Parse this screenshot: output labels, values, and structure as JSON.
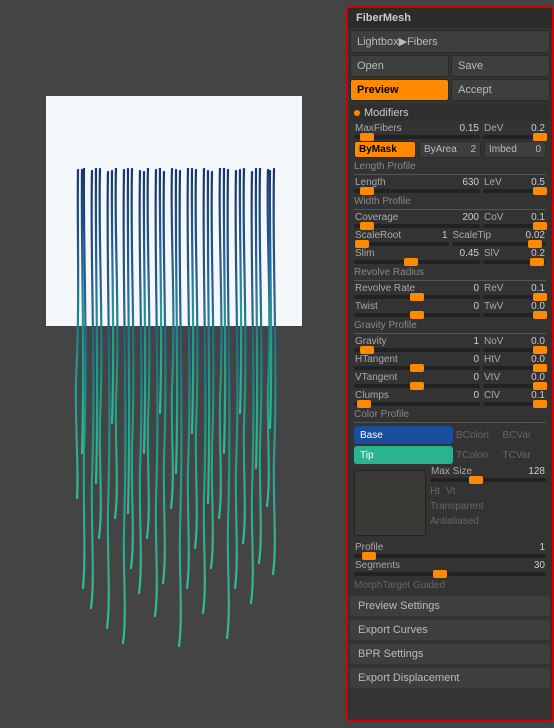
{
  "panel": {
    "title": "FiberMesh",
    "lightbox": {
      "label": "Lightbox▶Fibers"
    },
    "open": "Open",
    "save": "Save",
    "preview": "Preview",
    "accept": "Accept"
  },
  "modifiers": {
    "header": "Modifiers",
    "maxFibers": {
      "label": "MaxFibers",
      "value": "0.15"
    },
    "deV": {
      "label": "DeV",
      "value": "0.2"
    },
    "byMask": "ByMask",
    "byArea": {
      "label": "ByArea",
      "value": "2"
    },
    "imbed": {
      "label": "Imbed",
      "value": "0"
    },
    "lengthProfile": "Length Profile",
    "length": {
      "label": "Length",
      "value": "630"
    },
    "leV": {
      "label": "LeV",
      "value": "0.5"
    },
    "widthProfile": "Width Profile",
    "coverage": {
      "label": "Coverage",
      "value": "200"
    },
    "coV": {
      "label": "CoV",
      "value": "0.1"
    },
    "scaleRoot": {
      "label": "ScaleRoot",
      "value": "1"
    },
    "scaleTip": {
      "label": "ScaleTip",
      "value": "0.02"
    },
    "slim": {
      "label": "Slim",
      "value": "0.45"
    },
    "slV": {
      "label": "SlV",
      "value": "0.2"
    },
    "revolveRadius": "Revolve Radius",
    "revolveRate": {
      "label": "Revolve Rate",
      "value": "0"
    },
    "reV": {
      "label": "ReV",
      "value": "0.1"
    },
    "twist": {
      "label": "Twist",
      "value": "0"
    },
    "twV": {
      "label": "TwV",
      "value": "0.0"
    },
    "gravityProfile": "Gravity Profile",
    "gravity": {
      "label": "Gravity",
      "value": "1"
    },
    "noV": {
      "label": "NoV",
      "value": "0.0"
    },
    "hTangent": {
      "label": "HTangent",
      "value": "0"
    },
    "htV": {
      "label": "HtV",
      "value": "0.0"
    },
    "vTangent": {
      "label": "VTangent",
      "value": "0"
    },
    "vtV": {
      "label": "VtV",
      "value": "0.0"
    },
    "clumps": {
      "label": "Clumps",
      "value": "0"
    },
    "clV": {
      "label": "ClV",
      "value": "0.1"
    },
    "colorProfile": "Color Profile",
    "base": "Base",
    "bColorize": "BColori",
    "bCVar": "BCVar",
    "tip": "Tip",
    "tColorize": "TColori",
    "tCVar": "TCVar",
    "maxSize": {
      "label": "Max Size",
      "value": "128"
    },
    "ht": "Ht",
    "vt": "Vt",
    "transparent": "Transparent",
    "antialiased": "Antialiased",
    "profile": {
      "label": "Profile",
      "value": "1"
    },
    "segments": {
      "label": "Segments",
      "value": "30"
    },
    "morphTarget": "MorphTarget Guided"
  },
  "collapsed": {
    "previewSettings": "Preview Settings",
    "exportCurves": "Export Curves",
    "bprSettings": "BPR Settings",
    "exportDisplacement": "Export Displacement"
  },
  "colors": {
    "base": "#1a4d9c",
    "tip": "#29b38f"
  }
}
